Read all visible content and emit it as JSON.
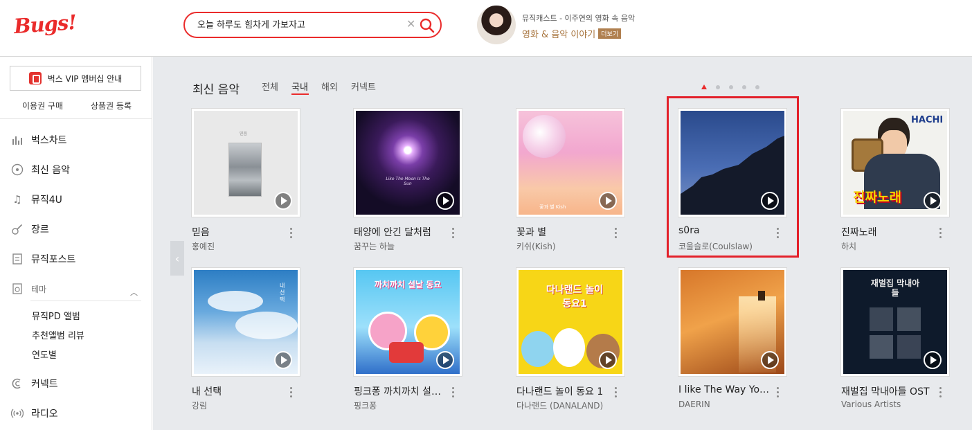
{
  "header": {
    "logo": "Bugs!",
    "search": {
      "value": "오늘 하루도 힘차게 가보자고",
      "clear_icon": "close-icon",
      "button_icon": "search-icon"
    },
    "promo": {
      "subtitle": "뮤직캐스트 - 이주연의 영화 속 음악",
      "title": "영화 & 음악 이야기",
      "more_label": "더보기"
    }
  },
  "sidebar": {
    "vip_label": "벅스 VIP 멤버십 안내",
    "sub_links": [
      "이용권 구매",
      "상품권 등록"
    ],
    "nav": [
      {
        "label": "벅스차트",
        "icon": "chart-icon"
      },
      {
        "label": "최신 음악",
        "icon": "new-music-icon"
      },
      {
        "label": "뮤직4U",
        "icon": "music-note-icon"
      },
      {
        "label": "장르",
        "icon": "guitar-icon"
      },
      {
        "label": "뮤직포스트",
        "icon": "post-icon"
      }
    ],
    "theme": {
      "label": "테마",
      "icon": "theme-icon",
      "items": [
        "뮤직PD 앨범",
        "추천앨범 리뷰",
        "연도별"
      ]
    },
    "bottom_nav": [
      {
        "label": "커넥트",
        "icon": "connect-icon"
      },
      {
        "label": "라디오",
        "icon": "radio-icon"
      }
    ]
  },
  "main": {
    "section_title": "최신 음악",
    "tabs": [
      "전체",
      "국내",
      "해외",
      "커넥트"
    ],
    "active_tab": "국내",
    "pagination": {
      "total": 5,
      "current": 1
    },
    "albums": [
      {
        "title": "믿음",
        "artist": "홍예진",
        "cover_text": "믿음"
      },
      {
        "title": "태양에 안긴 달처럼",
        "artist": "꿈꾸는 하늘",
        "cover_text": "Like The Moon Is The Sun"
      },
      {
        "title": "꽃과 별",
        "artist": "키쉬(Kish)",
        "cover_text": "꽃과 별 Kish"
      },
      {
        "title": "s0ra",
        "artist": "코울슬로(Coulslaw)",
        "cover_text": ""
      },
      {
        "title": "진짜노래",
        "artist": "하치",
        "cover_text": "진짜노래"
      },
      {
        "title": "내 선택",
        "artist": "강림",
        "cover_text": "내 선택"
      },
      {
        "title": "핑크퐁 까치까치 설날 동요",
        "artist": "핑크퐁",
        "cover_text": "까치까치 설날 동요"
      },
      {
        "title": "다나랜드 놀이 동요 1",
        "artist": "다나랜드 (DANALAND)",
        "cover_text": "다나랜드 놀이동요1"
      },
      {
        "title": "I like The Way You Are",
        "artist": "DAERIN",
        "cover_text": ""
      },
      {
        "title": "재벌집 막내아들 OST",
        "artist": "Various Artists",
        "cover_text": "재벌집 막내아들"
      }
    ]
  }
}
